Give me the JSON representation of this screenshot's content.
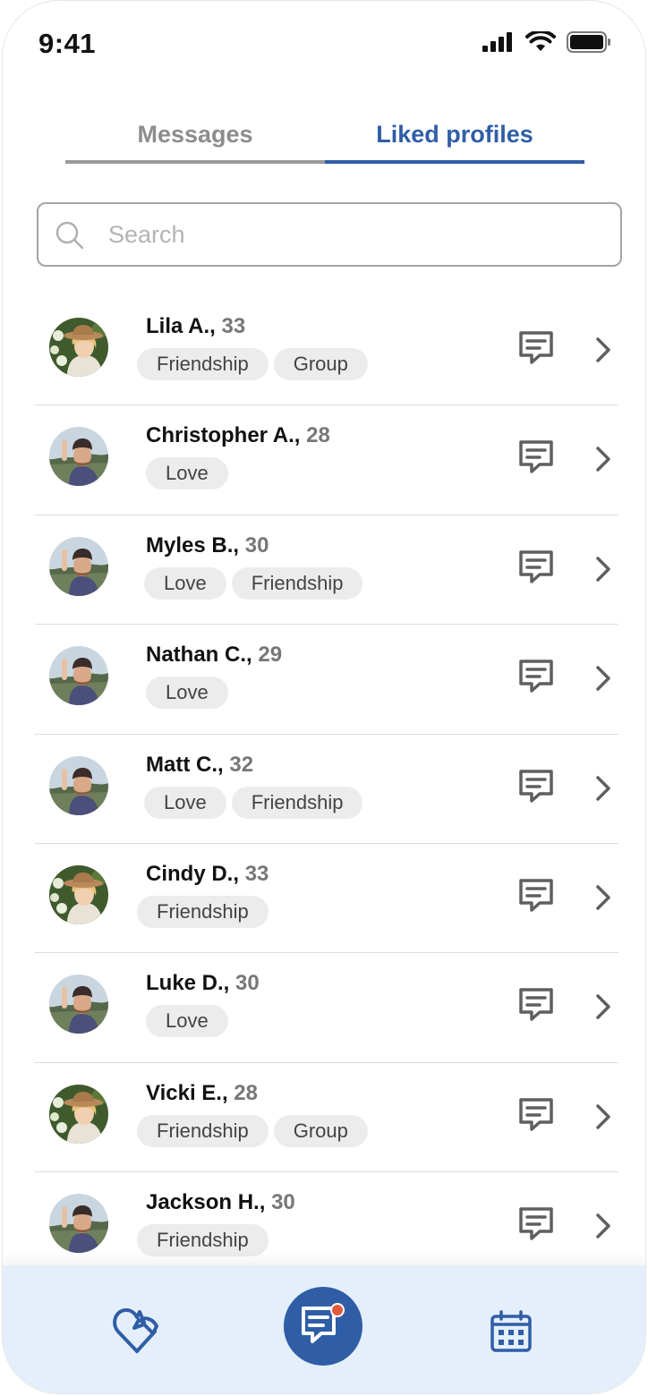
{
  "status_bar": {
    "time": "9:41"
  },
  "tabs": [
    {
      "label": "Messages",
      "active": false
    },
    {
      "label": "Liked profiles",
      "active": true
    }
  ],
  "search": {
    "placeholder": "Search",
    "value": ""
  },
  "profiles": [
    {
      "name": "Lila A.,",
      "age": "33",
      "tags": [
        "Friendship",
        "Group"
      ],
      "avatar": "woman"
    },
    {
      "name": "Christopher A.,",
      "age": "28",
      "tags": [
        "Love"
      ],
      "avatar": "man"
    },
    {
      "name": "Myles B.,",
      "age": "30",
      "tags": [
        "Love",
        "Friendship"
      ],
      "avatar": "man"
    },
    {
      "name": "Nathan C.,",
      "age": "29",
      "tags": [
        "Love"
      ],
      "avatar": "man"
    },
    {
      "name": "Matt C.,",
      "age": "32",
      "tags": [
        "Love",
        "Friendship"
      ],
      "avatar": "man"
    },
    {
      "name": "Cindy D.,",
      "age": "33",
      "tags": [
        "Friendship"
      ],
      "avatar": "woman"
    },
    {
      "name": "Luke D.,",
      "age": "30",
      "tags": [
        "Love"
      ],
      "avatar": "man"
    },
    {
      "name": "Vicki E.,",
      "age": "28",
      "tags": [
        "Friendship",
        "Group"
      ],
      "avatar": "woman"
    },
    {
      "name": "Jackson H.,",
      "age": "30",
      "tags": [
        "Friendship"
      ],
      "avatar": "man"
    }
  ],
  "bottom_nav": {
    "items": [
      {
        "icon": "heart-icon",
        "active": false
      },
      {
        "icon": "messages-icon",
        "active": true,
        "notification": true
      },
      {
        "icon": "calendar-icon",
        "active": false
      }
    ]
  },
  "colors": {
    "accent": "#2f5ea6",
    "inactive_tab": "#8d8d8d",
    "tag_bg": "#ececec",
    "nav_bg": "#e5effb",
    "notification": "#e05a3c"
  }
}
